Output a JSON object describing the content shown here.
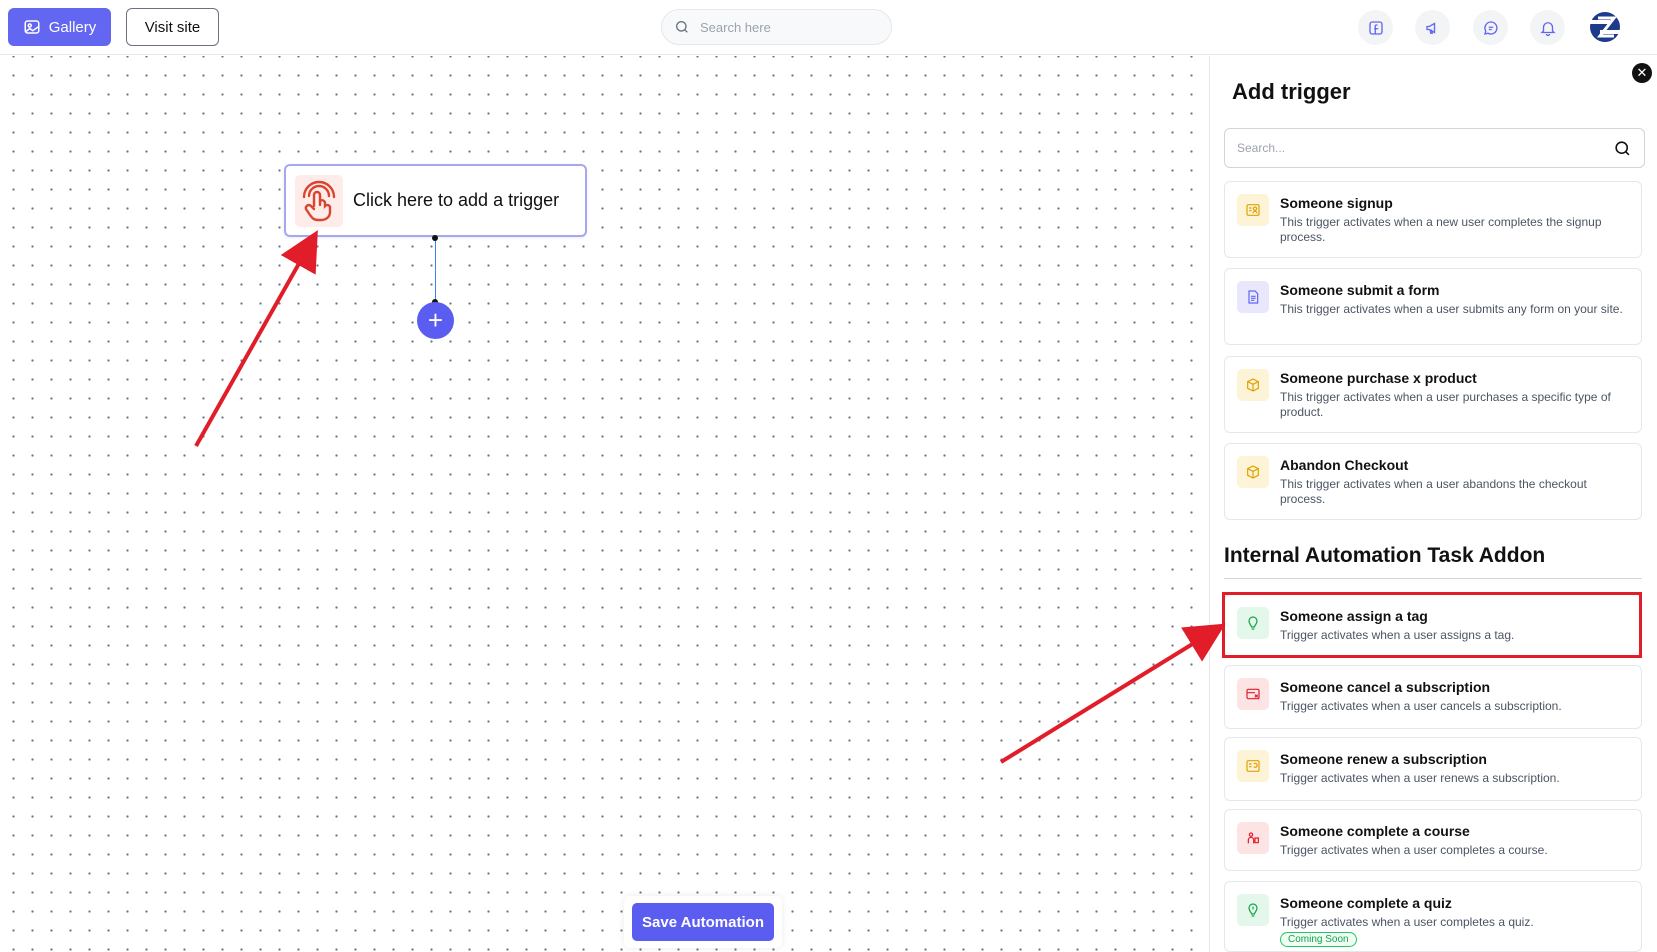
{
  "topbar": {
    "gallery_label": "Gallery",
    "visit_label": "Visit site",
    "search_placeholder": "Search here"
  },
  "canvas": {
    "trigger_node_label": "Click here to add a trigger",
    "plus_label": "+",
    "save_label": "Save Automation"
  },
  "panel": {
    "title": "Add trigger",
    "search_placeholder": "Search...",
    "close_label": "✕",
    "triggers": [
      {
        "title": "Someone signup",
        "desc": "This trigger activates when a new user completes the signup process.",
        "icon": "user-card-icon",
        "color": "#fdf3d6"
      },
      {
        "title": "Someone submit a form",
        "desc": "This trigger activates when a user submits any form on your site.",
        "icon": "document-icon",
        "color": "#e8e7fb"
      },
      {
        "title": "Someone purchase x product",
        "desc": "This trigger activates when a user purchases a specific type of product.",
        "icon": "box-icon",
        "color": "#fdf3d6"
      },
      {
        "title": "Abandon Checkout",
        "desc": "This trigger activates when a user abandons the checkout process.",
        "icon": "box-icon",
        "color": "#fdf3d6"
      }
    ],
    "section_title": "Internal Automation Task Addon",
    "addon_triggers": [
      {
        "title": "Someone assign a tag",
        "desc": "Trigger activates when a user assigns a tag.",
        "icon": "tag-icon",
        "color": "#e3f7ea"
      },
      {
        "title": "Someone cancel a subscription",
        "desc": "Trigger activates when a user cancels a subscription.",
        "icon": "cancel-card-icon",
        "color": "#fde4e4"
      },
      {
        "title": "Someone renew a subscription",
        "desc": "Trigger activates when a user renews a subscription.",
        "icon": "renew-card-icon",
        "color": "#fdf3d6"
      },
      {
        "title": "Someone complete a course",
        "desc": "Trigger activates when a user completes a course.",
        "icon": "course-icon",
        "color": "#fde4e4"
      },
      {
        "title": "Someone complete a quiz",
        "desc": "Trigger activates when a user completes a quiz.",
        "icon": "quiz-icon",
        "color": "#e3f7ea",
        "badge": "Coming Soon"
      }
    ]
  },
  "colors": {
    "accent": "#5b5cf0",
    "highlight": "#e11d2a"
  }
}
